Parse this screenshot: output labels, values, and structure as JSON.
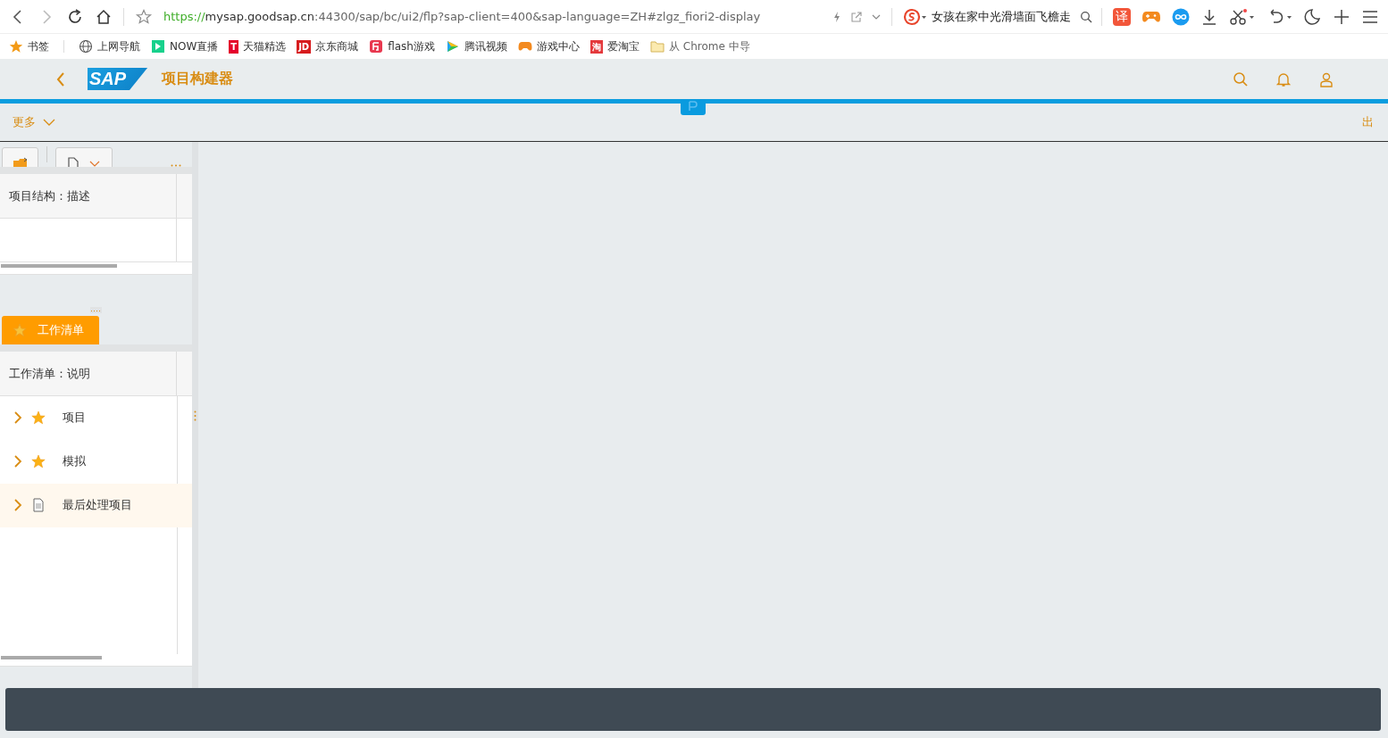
{
  "browser": {
    "url": {
      "scheme": "https://",
      "host": "mysap.goodsap.cn",
      "path": ":44300/sap/bc/ui2/flp?sap-client=400&sap-language=ZH#zlgz_fiori2-display"
    },
    "search": {
      "value": "女孩在家中光滑墙面飞檐走"
    },
    "translate_label": "译"
  },
  "bookmarks": [
    {
      "kind": "star",
      "label": "书签"
    },
    {
      "kind": "globe",
      "label": "上网导航"
    },
    {
      "kind": "now",
      "label": "NOW直播"
    },
    {
      "kind": "tmall",
      "label": "天猫精选",
      "badge": "T"
    },
    {
      "kind": "jd",
      "label": "京东商城",
      "badge": "JD"
    },
    {
      "kind": "flash",
      "label": "flash游戏"
    },
    {
      "kind": "video",
      "label": "腾讯视频"
    },
    {
      "kind": "game",
      "label": "游戏中心"
    },
    {
      "kind": "taobao",
      "label": "爱淘宝",
      "badge": "淘"
    },
    {
      "kind": "folder",
      "label": "从 Chrome 中导"
    }
  ],
  "shell": {
    "logo": "SAP",
    "title": "项目构建器"
  },
  "toolbar": {
    "more": "更多",
    "exit": "出"
  },
  "structure_table": {
    "columns": [
      "项目结构：描述"
    ]
  },
  "worklist_tab": {
    "label": "工作清单",
    "selected": true
  },
  "worklist_table": {
    "columns": [
      "工作清单：说明"
    ],
    "rows": [
      {
        "kind": "star",
        "label": "项目",
        "selected": false
      },
      {
        "kind": "star",
        "label": "模拟",
        "selected": false
      },
      {
        "kind": "document",
        "label": "最后处理项目",
        "selected": true
      }
    ]
  }
}
